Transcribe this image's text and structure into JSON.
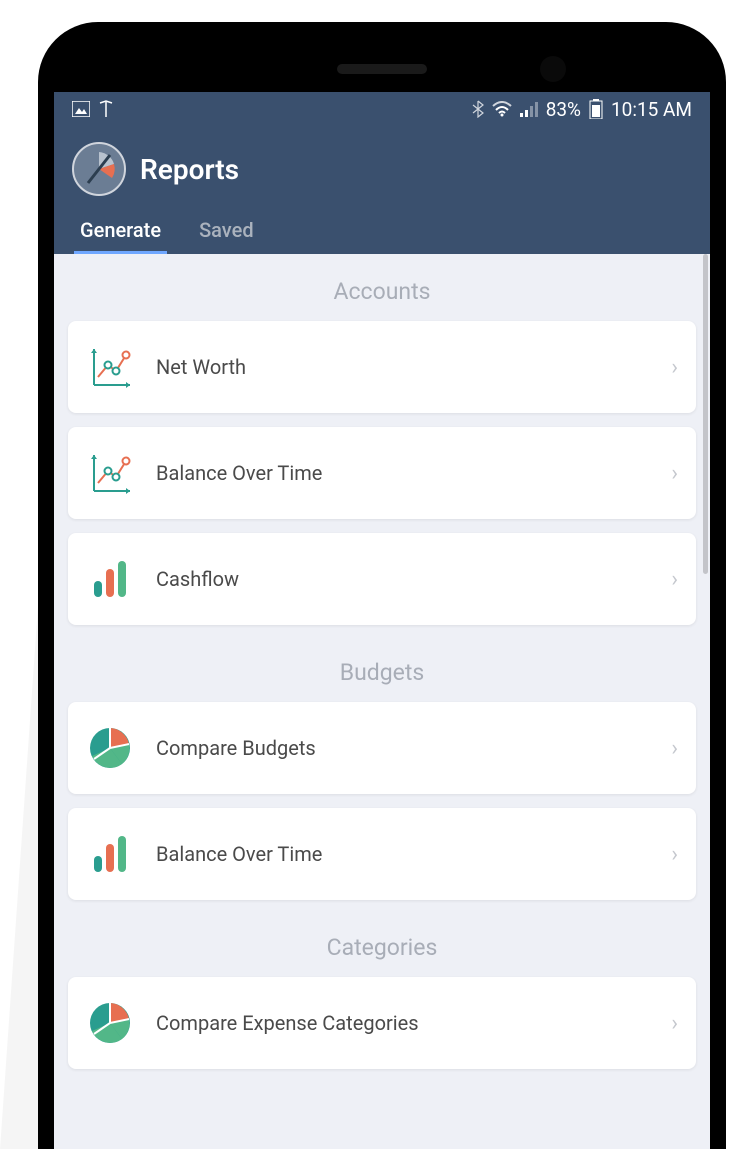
{
  "status_bar": {
    "battery_pct": "83%",
    "time": "10:15 AM"
  },
  "header": {
    "title": "Reports",
    "tabs": [
      {
        "label": "Generate",
        "active": true
      },
      {
        "label": "Saved",
        "active": false
      }
    ]
  },
  "sections": [
    {
      "title": "Accounts",
      "items": [
        {
          "label": "Net Worth",
          "icon": "line-chart"
        },
        {
          "label": "Balance Over Time",
          "icon": "line-chart"
        },
        {
          "label": "Cashflow",
          "icon": "bar-chart"
        }
      ]
    },
    {
      "title": "Budgets",
      "items": [
        {
          "label": "Compare Budgets",
          "icon": "pie-chart"
        },
        {
          "label": "Balance Over Time",
          "icon": "bar-chart"
        }
      ]
    },
    {
      "title": "Categories",
      "items": [
        {
          "label": "Compare Expense Categories",
          "icon": "pie-chart"
        }
      ]
    }
  ],
  "colors": {
    "header_bg": "#3a506e",
    "content_bg": "#eef0f6",
    "teal": "#2a9d8f",
    "orange": "#e76f51",
    "green": "#52b788",
    "muted": "#a8adb7"
  }
}
